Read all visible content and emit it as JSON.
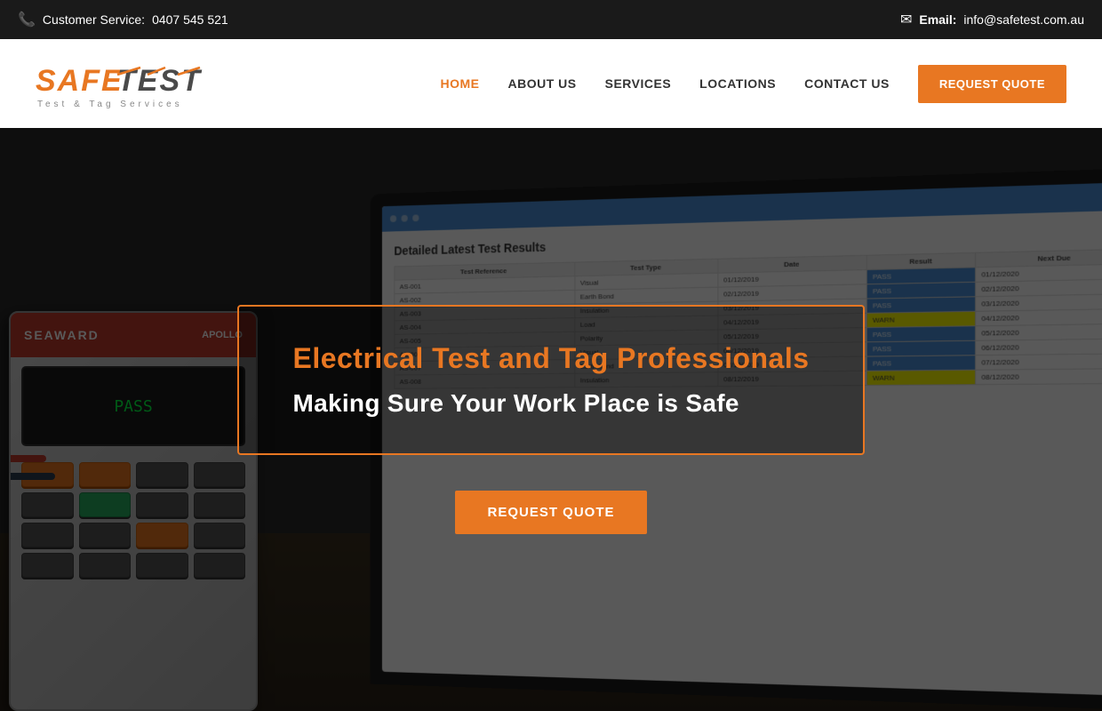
{
  "topbar": {
    "phone_icon": "📞",
    "customer_service_label": "Customer Service:",
    "phone_number": "0407 545 521",
    "email_icon": "✉",
    "email_label": "Email:",
    "email_address": "info@safetest.com.au"
  },
  "navbar": {
    "logo_main": "SAFETEST",
    "logo_safe": "SAFE",
    "logo_test": "TEST",
    "logo_subtitle": "Test & Tag Services",
    "nav_links": [
      {
        "id": "home",
        "label": "HOME",
        "active": true
      },
      {
        "id": "about",
        "label": "ABOUT US",
        "active": false
      },
      {
        "id": "services",
        "label": "SERVICES",
        "active": false
      },
      {
        "id": "locations",
        "label": "LOCATIONS",
        "active": false
      },
      {
        "id": "contact",
        "label": "CONTACT US",
        "active": false
      }
    ],
    "request_quote_btn": "REQUEST QUOTE"
  },
  "hero": {
    "title": "Electrical Test and Tag Professionals",
    "subtitle": "Making Sure Your Work Place is Safe",
    "cta_button": "REQUEST QUOTE",
    "equipment_brand": "SEAWARD",
    "equipment_model": "APOLLO",
    "screen_title": "Detailed Latest Test Results"
  }
}
